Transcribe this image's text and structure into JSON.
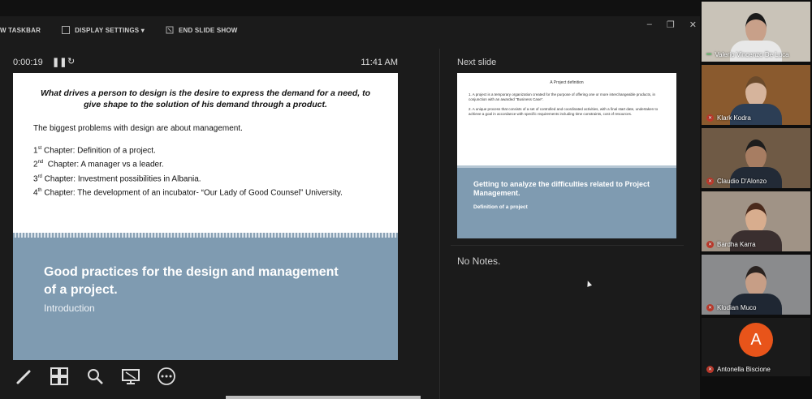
{
  "toolbar": {
    "taskbar_label": "W TASKBAR",
    "display_settings_label": "DISPLAY SETTINGS ▾",
    "end_show_label": "END SLIDE SHOW"
  },
  "presenter": {
    "timer": "0:00:19",
    "clock": "11:41 AM"
  },
  "slide": {
    "quote": "What drives a person to design is the desire to express the demand for a need, to give shape to the solution of his demand through a product.",
    "intro": "The biggest problems with design are about management.",
    "chapters": [
      {
        "num": "1",
        "sup": "st",
        "text": " Chapter: Definition of a project."
      },
      {
        "num": "2",
        "sup": "nd",
        "text": "  Chapter: A manager vs a leader."
      },
      {
        "num": "3",
        "sup": "rd",
        "text": " Chapter: Investment possibilities in Albania."
      },
      {
        "num": "4",
        "sup": "th",
        "text": " Chapter: The development of an incubator- “Our Lady of Good Counsel” University."
      }
    ],
    "title": "Good practices for the design and management of a project.",
    "subtitle": "Introduction"
  },
  "next": {
    "label": "Next slide",
    "title": "A Project definition",
    "items": [
      "1.   A project is a temporary organization created for the purpose of offering one or more interchangeable products, in conjunction with an awarded \"Business Case\".",
      "2.   A unique process that consists of a set of controlled and coordinated activities, with a final start date, undertaken to achieve a goal in accordance with specific requirements including time constraints, cost of resources."
    ],
    "heading": "Getting to analyze the difficulties related to Project Management.",
    "sub": "Definition of a project"
  },
  "notes": "No Notes.",
  "participants": [
    {
      "name": "Valerio Vincenzo De Luca",
      "bg": "#c9c3b8",
      "skin": "#c8a089",
      "shirt": "#e8e8e8",
      "hair": "#1a1a1a"
    },
    {
      "name": "Klark Kodra",
      "bg": "#8a5a2e",
      "skin": "#d6b49c",
      "shirt": "#2c3e55",
      "hair": "#6b4a2b"
    },
    {
      "name": "Claudio D'Alonzo",
      "bg": "#6f5a45",
      "skin": "#a77d62",
      "shirt": "#222a36",
      "hair": "#1d1d1d"
    },
    {
      "name": "Bardha Karra",
      "bg": "#a09386",
      "skin": "#d8ad8e",
      "shirt": "#3a2f2f",
      "hair": "#4a2a1c"
    },
    {
      "name": "Klodian Muco",
      "bg": "#8a8b8d",
      "skin": "#c79e86",
      "shirt": "#1f2733",
      "hair": "#2a2320"
    }
  ],
  "avatar_participant": {
    "initial": "A",
    "name": "Antonella Biscione"
  }
}
